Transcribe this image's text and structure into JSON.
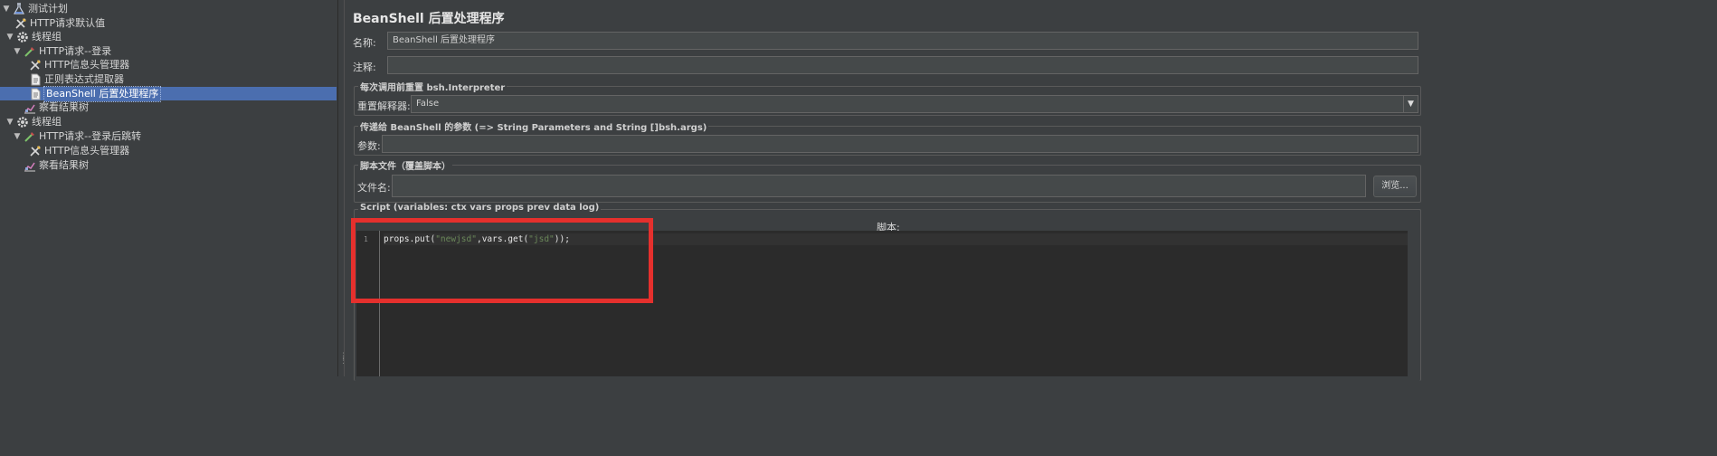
{
  "tree": {
    "items": [
      {
        "label": "测试计划",
        "icon": "flask-icon",
        "expanded": true
      },
      {
        "label": "HTTP请求默认值",
        "icon": "wrench-icon"
      },
      {
        "label": "线程组",
        "icon": "gear-icon",
        "expanded": true
      },
      {
        "label": "HTTP请求--登录",
        "icon": "pipette-icon",
        "expanded": true
      },
      {
        "label": "HTTP信息头管理器",
        "icon": "wrench-icon"
      },
      {
        "label": "正则表达式提取器",
        "icon": "document-icon"
      },
      {
        "label": "BeanShell 后置处理程序",
        "icon": "document-icon",
        "selected": true
      },
      {
        "label": "察看结果树",
        "icon": "chart-icon"
      },
      {
        "label": "线程组",
        "icon": "gear-icon",
        "expanded": true
      },
      {
        "label": "HTTP请求--登录后跳转",
        "icon": "pipette-icon",
        "expanded": true
      },
      {
        "label": "HTTP信息头管理器",
        "icon": "wrench-icon"
      },
      {
        "label": "察看结果树",
        "icon": "chart-icon"
      }
    ]
  },
  "editor": {
    "title": "BeanShell 后置处理程序",
    "name_label": "名称:",
    "name_value": "BeanShell 后置处理程序",
    "comment_label": "注释:",
    "comment_value": "",
    "reset_group_title": "每次调用前重置 bsh.Interpreter",
    "reset_label": "重置解释器:",
    "reset_value": "False",
    "params_group_title": "传递给 BeanShell 的参数 (=> String Parameters and String []bsh.args)",
    "params_label": "参数:",
    "params_value": "",
    "file_group_title": "脚本文件（覆盖脚本）",
    "file_label": "文件名:",
    "file_value": "",
    "browse_label": "浏览...",
    "script_group_title": "Script (variables: ctx vars props prev data log)",
    "script_header": "脚本:",
    "line_number": "1",
    "code": {
      "p1": "props.put(",
      "s1": "\"newjsd\"",
      "p2": ",vars.get(",
      "s2": "\"jsd\"",
      "p3": "));"
    }
  },
  "colors": {
    "background": "#3c3f41",
    "selection": "#4b6eaf",
    "code_background": "#2b2b2b",
    "string_literal": "#6a8759",
    "highlight_box": "#e5302d"
  }
}
